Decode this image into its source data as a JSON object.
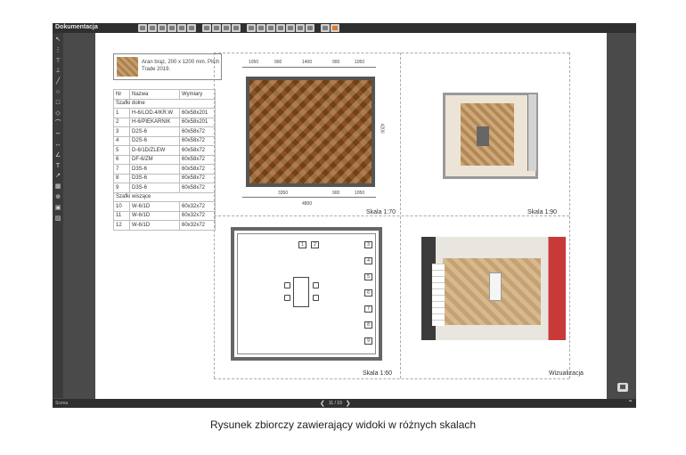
{
  "app": {
    "title": "Dokumentacja",
    "toolbar_icons": [
      "print-icon",
      "print-icon",
      "print-icon",
      "print-icon",
      "settings-icon",
      "save-icon",
      "copy-icon",
      "cut-icon",
      "paste-icon",
      "delete-icon",
      "view-icon",
      "view-icon",
      "view-icon",
      "view-icon",
      "view-icon",
      "view-icon",
      "view-icon",
      "export-icon",
      "export-accent-icon"
    ],
    "tools": [
      "pointer-icon",
      "grid-icon",
      "align-top-icon",
      "align-bottom-icon",
      "line-icon",
      "circle-icon",
      "rectangle-icon",
      "polygon-icon",
      "arc-icon",
      "curve-icon",
      "measure-icon",
      "angle-icon",
      "text-icon",
      "arrow-icon",
      "table-icon",
      "stamp-icon",
      "frame-icon",
      "image-icon"
    ],
    "status_left": "Scena",
    "pager": {
      "current": "11",
      "total": "19",
      "label": "11 / 19"
    }
  },
  "sample": {
    "text": "Aran brąz, 200 x 1200 mm. Pilch Trade 2019."
  },
  "table": {
    "headers": [
      "Nr",
      "Nazwa",
      "Wymiary"
    ],
    "sections": [
      {
        "title": "Szafki dolne",
        "rows": [
          [
            "1",
            "H-6/LOD.4/KR.W",
            "60x58x201"
          ],
          [
            "2",
            "H-6/PIEKARNIK",
            "60x58x201"
          ],
          [
            "3",
            "D2S-6",
            "60x58x72"
          ],
          [
            "4",
            "D2S-6",
            "60x58x72"
          ],
          [
            "5",
            "D-6/1D/ZLEW",
            "60x58x72"
          ],
          [
            "6",
            "DF-6/ZM",
            "60x58x72"
          ],
          [
            "7",
            "D3S-6",
            "60x58x72"
          ],
          [
            "8",
            "D3S-6",
            "60x58x72"
          ],
          [
            "9",
            "D3S-6",
            "60x58x72"
          ]
        ]
      },
      {
        "title": "Szafki wiszące",
        "rows": [
          [
            "10",
            "W-6/1D",
            "60x32x72"
          ],
          [
            "11",
            "W-6/1D",
            "60x32x72"
          ],
          [
            "12",
            "W-6/1D",
            "60x32x72"
          ]
        ]
      }
    ]
  },
  "views": {
    "plan1": {
      "scale": "Skala 1:70",
      "dims_top": [
        "1050",
        "900",
        "1400",
        "900",
        "1050"
      ],
      "dims_bottom": [
        "3350",
        "900",
        "1050"
      ],
      "total": "4800",
      "side": "4200"
    },
    "plan2": {
      "scale": "Skala 1:90"
    },
    "plan3": {
      "scale": "Skala 1:60",
      "top_cabinets": [
        "1",
        "2"
      ],
      "right_cabinets": [
        "3",
        "4",
        "5",
        "6",
        "7",
        "8",
        "9"
      ]
    },
    "viz": {
      "label": "Wizualizacja"
    }
  },
  "caption": "Rysunek zbiorczy zawierający widoki w różnych skalach"
}
